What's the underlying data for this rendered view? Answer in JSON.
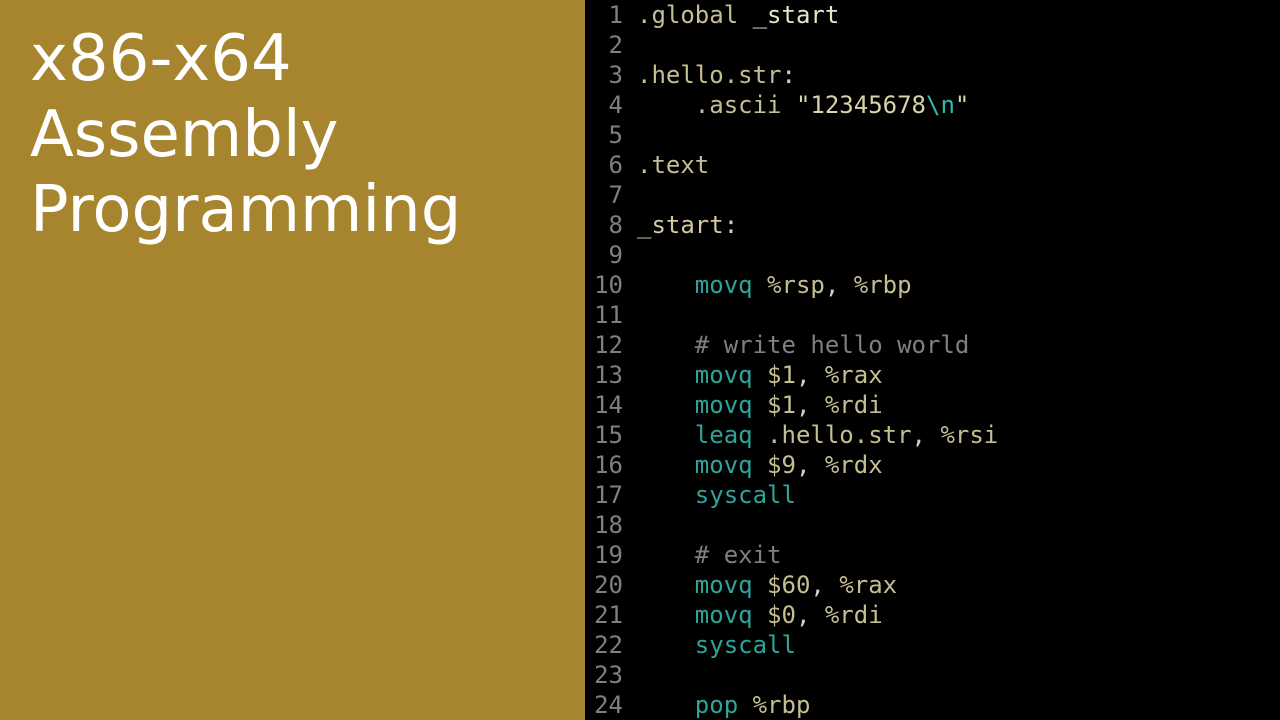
{
  "title": {
    "line1": "x86-x64",
    "line2": "Assembly",
    "line3": "Programming"
  },
  "code": {
    "lines": [
      {
        "n": 1,
        "tokens": [
          {
            "cls": "tk-dir",
            "t": ".global "
          },
          {
            "cls": "tk-ident",
            "t": "_start"
          }
        ]
      },
      {
        "n": 2,
        "tokens": []
      },
      {
        "n": 3,
        "tokens": [
          {
            "cls": "tk-dir",
            "t": ".hello.str"
          },
          {
            "cls": "tk-punc",
            "t": ":"
          }
        ]
      },
      {
        "n": 4,
        "tokens": [
          {
            "cls": "tk-plain",
            "t": "    "
          },
          {
            "cls": "tk-dir",
            "t": ".ascii "
          },
          {
            "cls": "tk-quot",
            "t": "\""
          },
          {
            "cls": "tk-str",
            "t": "12345678"
          },
          {
            "cls": "tk-esc",
            "t": "\\n"
          },
          {
            "cls": "tk-quot",
            "t": "\""
          }
        ]
      },
      {
        "n": 5,
        "tokens": []
      },
      {
        "n": 6,
        "tokens": [
          {
            "cls": "tk-dir",
            "t": ".text"
          }
        ]
      },
      {
        "n": 7,
        "tokens": []
      },
      {
        "n": 8,
        "tokens": [
          {
            "cls": "tk-label",
            "t": "_start"
          },
          {
            "cls": "tk-punc",
            "t": ":"
          }
        ]
      },
      {
        "n": 9,
        "tokens": []
      },
      {
        "n": 10,
        "tokens": [
          {
            "cls": "tk-plain",
            "t": "    "
          },
          {
            "cls": "tk-mnem",
            "t": "movq "
          },
          {
            "cls": "tk-reg",
            "t": "%rsp"
          },
          {
            "cls": "tk-punc",
            "t": ", "
          },
          {
            "cls": "tk-reg",
            "t": "%rbp"
          }
        ]
      },
      {
        "n": 11,
        "tokens": []
      },
      {
        "n": 12,
        "tokens": [
          {
            "cls": "tk-plain",
            "t": "    "
          },
          {
            "cls": "tk-comment",
            "t": "# write hello world"
          }
        ]
      },
      {
        "n": 13,
        "tokens": [
          {
            "cls": "tk-plain",
            "t": "    "
          },
          {
            "cls": "tk-mnem",
            "t": "movq "
          },
          {
            "cls": "tk-num",
            "t": "$1"
          },
          {
            "cls": "tk-punc",
            "t": ", "
          },
          {
            "cls": "tk-reg",
            "t": "%rax"
          }
        ]
      },
      {
        "n": 14,
        "tokens": [
          {
            "cls": "tk-plain",
            "t": "    "
          },
          {
            "cls": "tk-mnem",
            "t": "movq "
          },
          {
            "cls": "tk-num",
            "t": "$1"
          },
          {
            "cls": "tk-punc",
            "t": ", "
          },
          {
            "cls": "tk-reg",
            "t": "%rdi"
          }
        ]
      },
      {
        "n": 15,
        "tokens": [
          {
            "cls": "tk-plain",
            "t": "    "
          },
          {
            "cls": "tk-mnem",
            "t": "leaq "
          },
          {
            "cls": "tk-dir",
            "t": ".hello.str"
          },
          {
            "cls": "tk-punc",
            "t": ", "
          },
          {
            "cls": "tk-reg",
            "t": "%rsi"
          }
        ]
      },
      {
        "n": 16,
        "tokens": [
          {
            "cls": "tk-plain",
            "t": "    "
          },
          {
            "cls": "tk-mnem",
            "t": "movq "
          },
          {
            "cls": "tk-num",
            "t": "$9"
          },
          {
            "cls": "tk-punc",
            "t": ", "
          },
          {
            "cls": "tk-reg",
            "t": "%rdx"
          }
        ]
      },
      {
        "n": 17,
        "tokens": [
          {
            "cls": "tk-plain",
            "t": "    "
          },
          {
            "cls": "tk-mnem",
            "t": "syscall"
          }
        ]
      },
      {
        "n": 18,
        "tokens": []
      },
      {
        "n": 19,
        "tokens": [
          {
            "cls": "tk-plain",
            "t": "    "
          },
          {
            "cls": "tk-comment",
            "t": "# exit"
          }
        ]
      },
      {
        "n": 20,
        "tokens": [
          {
            "cls": "tk-plain",
            "t": "    "
          },
          {
            "cls": "tk-mnem",
            "t": "movq "
          },
          {
            "cls": "tk-num",
            "t": "$60"
          },
          {
            "cls": "tk-punc",
            "t": ", "
          },
          {
            "cls": "tk-reg",
            "t": "%rax"
          }
        ]
      },
      {
        "n": 21,
        "tokens": [
          {
            "cls": "tk-plain",
            "t": "    "
          },
          {
            "cls": "tk-mnem",
            "t": "movq "
          },
          {
            "cls": "tk-num",
            "t": "$0"
          },
          {
            "cls": "tk-punc",
            "t": ", "
          },
          {
            "cls": "tk-reg",
            "t": "%rdi"
          }
        ]
      },
      {
        "n": 22,
        "tokens": [
          {
            "cls": "tk-plain",
            "t": "    "
          },
          {
            "cls": "tk-mnem",
            "t": "syscall"
          }
        ]
      },
      {
        "n": 23,
        "tokens": []
      },
      {
        "n": 24,
        "tokens": [
          {
            "cls": "tk-plain",
            "t": "    "
          },
          {
            "cls": "tk-mnem",
            "t": "pop "
          },
          {
            "cls": "tk-reg",
            "t": "%rbp"
          }
        ]
      }
    ]
  }
}
